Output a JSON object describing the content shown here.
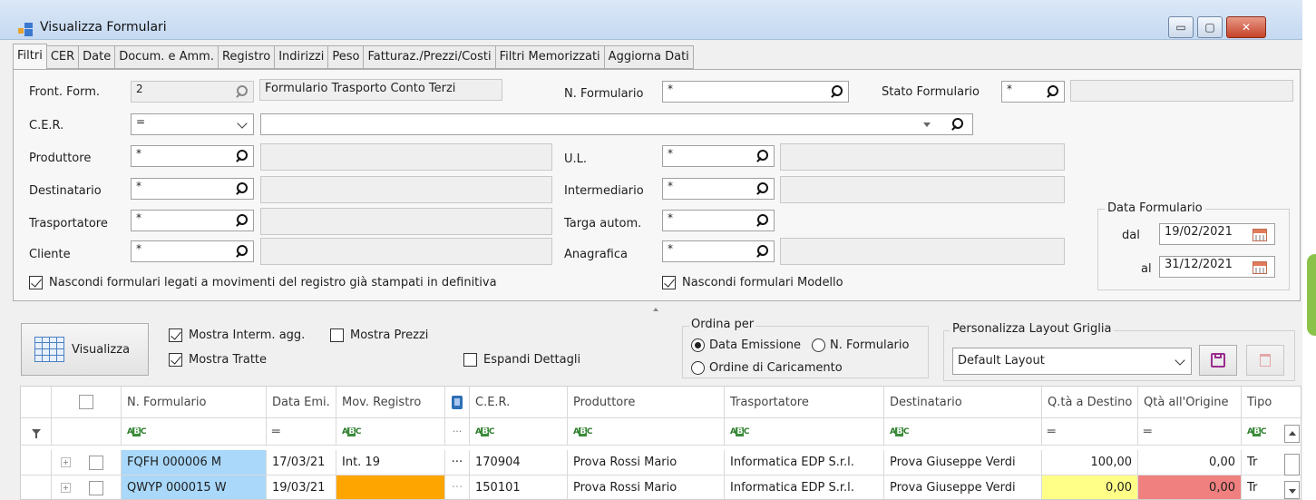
{
  "window": {
    "title": "Visualizza Formulari",
    "minimize": "▭",
    "maximize": "▢",
    "close": "✕"
  },
  "tabs": [
    "Filtri",
    "CER",
    "Date",
    "Docum. e Amm.",
    "Registro",
    "Indirizzi",
    "Peso",
    "Fatturaz./Prezzi/Costi",
    "Filtri Memorizzati",
    "Aggiorna Dati"
  ],
  "filters": {
    "front_form": {
      "label": "Front. Form.",
      "value": "2",
      "desc": "Formulario Trasporto Conto Terzi"
    },
    "n_formulario": {
      "label": "N. Formulario",
      "value": "*"
    },
    "stato_formulario": {
      "label": "Stato Formulario",
      "value": "*"
    },
    "cer": {
      "label": "C.E.R.",
      "value": "="
    },
    "produttore": {
      "label": "Produttore",
      "value": "*"
    },
    "destinatario": {
      "label": "Destinatario",
      "value": "*"
    },
    "trasportatore": {
      "label": "Trasportatore",
      "value": "*"
    },
    "cliente": {
      "label": "Cliente",
      "value": "*"
    },
    "ul": {
      "label": "U.L.",
      "value": "*"
    },
    "intermediario": {
      "label": "Intermediario",
      "value": "*"
    },
    "targa": {
      "label": "Targa autom.",
      "value": "*"
    },
    "anagrafica": {
      "label": "Anagrafica",
      "value": "*"
    },
    "hide_stampati": "Nascondi formulari legati a movimenti del registro già stampati in definitiva",
    "hide_modello": "Nascondi formulari Modello"
  },
  "data_formulario": {
    "title": "Data Formulario",
    "dal_label": "dal",
    "dal": "19/02/2021",
    "al_label": "al",
    "al": "31/12/2021"
  },
  "options": {
    "visualizza": "Visualizza",
    "mostra_interm": "Mostra Interm. agg.",
    "mostra_prezzi": "Mostra Prezzi",
    "mostra_tratte": "Mostra Tratte",
    "espandi": "Espandi Dettagli"
  },
  "ordina": {
    "title": "Ordina per",
    "data_emissione": "Data Emissione",
    "n_formulario": "N. Formulario",
    "ordine_caricamento": "Ordine di Caricamento"
  },
  "layout": {
    "title": "Personalizza Layout Griglia",
    "value": "Default Layout"
  },
  "grid": {
    "headers": [
      "N. Formulario",
      "Data Emi.",
      "Mov. Registro",
      "C.E.R.",
      "Produttore",
      "Trasportatore",
      "Destinatario",
      "Q.tà a Destino",
      "Qtà all'Origine",
      "Tipo"
    ],
    "filter_ellipsis": "···",
    "rows": [
      {
        "nf": "FQFH 000006 M",
        "data": "17/03/21",
        "mov": "Int. 19",
        "dots": "···",
        "cer": "170904",
        "prod": "Prova Rossi Mario",
        "trasp": "Informatica EDP S.r.l.",
        "dest": "Prova Giuseppe Verdi",
        "qdest": "100,00",
        "qorig": "0,00",
        "tipo": "Tr"
      },
      {
        "nf": "QWYP 000015 W",
        "data": "19/03/21",
        "mov": "",
        "dots": "···",
        "cer": "150101",
        "prod": "Prova Rossi Mario",
        "trasp": "Informatica EDP S.r.l.",
        "dest": "Prova Giuseppe Verdi",
        "qdest": "0,00",
        "qorig": "0,00",
        "tipo": "Tr"
      }
    ]
  },
  "colors": {
    "selected_cell": "#a9d8fa",
    "orange": "#ffa500",
    "yellow": "#ffff88",
    "red": "#f08080"
  }
}
